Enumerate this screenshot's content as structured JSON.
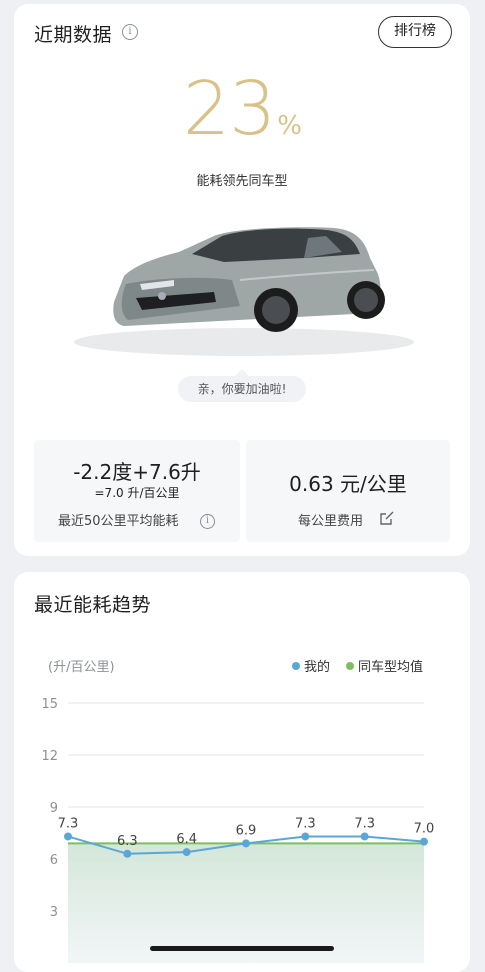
{
  "recent": {
    "title": "近期数据",
    "info_icon": "info-icon",
    "rank_button": "排行榜",
    "percent_value": "23",
    "percent_sign": "%",
    "percent_subtitle": "能耗领先同车型",
    "car_image": "car-image",
    "bubble_text": "亲，你要加油啦!",
    "stat_left": {
      "main": "-2.2度+7.6升",
      "small": "=7.0 升/百公里",
      "label": "最近50公里平均能耗"
    },
    "stat_right": {
      "value": "0.63 元/公里",
      "label": "每公里费用"
    }
  },
  "trend": {
    "title": "最近能耗趋势",
    "unit": "(升/百公里)",
    "legend_mine": "我的",
    "legend_avg": "同车型均值",
    "colors": {
      "mine": "#5aa7d6",
      "avg": "#7cbf5f",
      "accent": "#d8c289"
    }
  },
  "chart_data": {
    "type": "line",
    "ylabel": "(升/百公里)",
    "y_ticks": [
      15,
      12,
      9,
      6,
      3
    ],
    "ylim": [
      0,
      15
    ],
    "series": [
      {
        "name": "我的",
        "values": [
          7.3,
          6.3,
          6.4,
          6.9,
          7.3,
          7.3,
          7.0
        ],
        "labels": [
          "7.3",
          "6.3",
          "6.4",
          "6.9",
          "7.3",
          "7.3",
          "7.0"
        ]
      },
      {
        "name": "同车型均值",
        "values": [
          6.9,
          6.9,
          6.9,
          6.9,
          6.9,
          6.9,
          6.9
        ]
      }
    ],
    "grid": true,
    "legend": "top-right"
  }
}
